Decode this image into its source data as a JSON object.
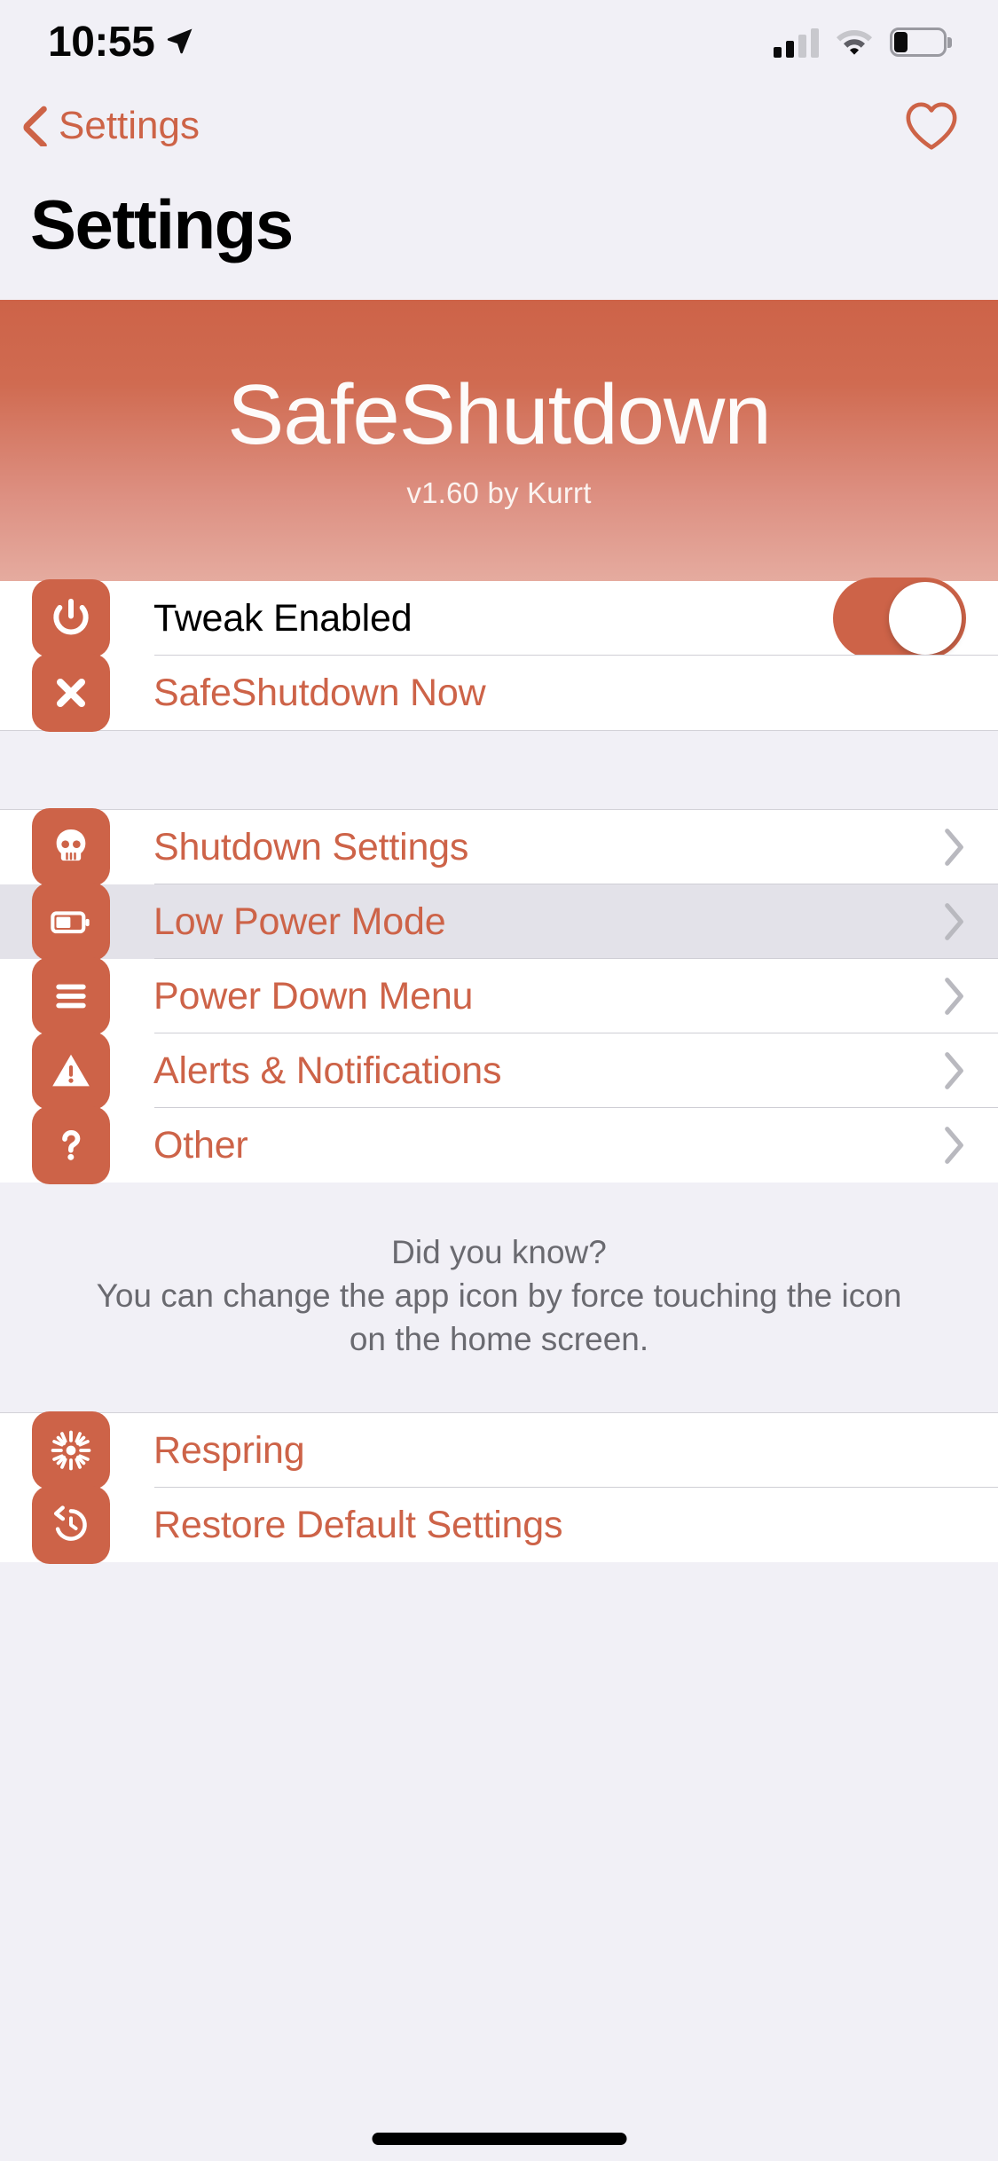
{
  "status_bar": {
    "time": "10:55",
    "location_icon": "location-arrow-icon",
    "signal_icon": "cellular-signal-icon",
    "signal_bars_filled": 2,
    "signal_bars_total": 4,
    "wifi_icon": "wifi-icon",
    "battery_icon": "battery-icon",
    "battery_level_percent": 25
  },
  "nav": {
    "back_label": "Settings",
    "back_icon": "chevron-left-icon",
    "favorite_icon": "heart-icon"
  },
  "page_title": "Settings",
  "banner": {
    "title": "SafeShutdown",
    "subtitle": "v1.60 by Kurrt",
    "gradient_top": "#cd6348",
    "gradient_bottom": "#e5ab9f"
  },
  "theme": {
    "accent": "#cd6348",
    "background": "#f1f0f6",
    "cell_background": "#ffffff",
    "selected_background": "#e3e2e9",
    "separator": "#cfced5",
    "footnote_text": "#6a6a70"
  },
  "sections": [
    {
      "name": "main-actions",
      "rows": [
        {
          "label": "Tweak Enabled",
          "icon": "power-icon",
          "type": "toggle",
          "toggle_on": true,
          "label_style": "dark"
        },
        {
          "label": "SafeShutdown Now",
          "icon": "close-x-icon",
          "type": "action",
          "label_style": "accent"
        }
      ]
    },
    {
      "name": "configuration",
      "rows": [
        {
          "label": "Shutdown Settings",
          "icon": "skull-icon",
          "type": "disclosure",
          "label_style": "accent",
          "selected": false
        },
        {
          "label": "Low Power Mode",
          "icon": "battery-icon",
          "type": "disclosure",
          "label_style": "accent",
          "selected": true
        },
        {
          "label": "Power Down Menu",
          "icon": "list-lines-icon",
          "type": "disclosure",
          "label_style": "accent",
          "selected": false
        },
        {
          "label": "Alerts & Notifications",
          "icon": "warning-triangle-icon",
          "type": "disclosure",
          "label_style": "accent",
          "selected": false
        },
        {
          "label": "Other",
          "icon": "question-mark-icon",
          "type": "disclosure",
          "label_style": "accent",
          "selected": false
        }
      ]
    },
    {
      "name": "maintenance",
      "rows": [
        {
          "label": "Respring",
          "icon": "sunburst-icon",
          "type": "action",
          "label_style": "accent"
        },
        {
          "label": "Restore Default Settings",
          "icon": "clock-rewind-icon",
          "type": "action",
          "label_style": "accent"
        }
      ]
    }
  ],
  "footnote": {
    "heading": "Did you know?",
    "line1": "You can change the app icon by force touching the icon",
    "line2": "on the home screen."
  }
}
